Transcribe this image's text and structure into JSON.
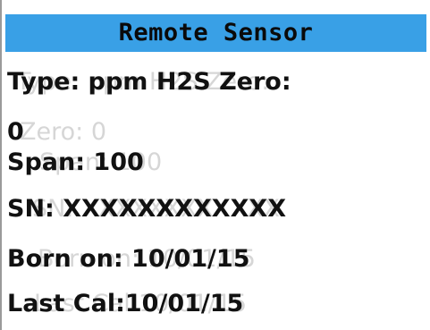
{
  "header": {
    "title": "Remote Sensor"
  },
  "lines": [
    {
      "text": "Type: ppm H2S Zero:",
      "ghost": "Type: ppm H2S Zero:"
    },
    {
      "text": "0",
      "ghost": "Zero: 0"
    },
    {
      "text": "Span: 100",
      "ghost": "Span: 100"
    },
    {
      "text": "SN: XXXXXXXXXXXX",
      "ghost": "SN: XXXXXXXXXXXX"
    },
    {
      "text": "Born on: 10/01/15",
      "ghost": "Born on: 10/01/15"
    },
    {
      "text": "Last Cal:10/01/15",
      "ghost": "Last Cal:10/01/15"
    }
  ],
  "colors": {
    "header_bg": "#39a0e6",
    "text": "#111111",
    "ghost_text": "#d6d6d6"
  }
}
